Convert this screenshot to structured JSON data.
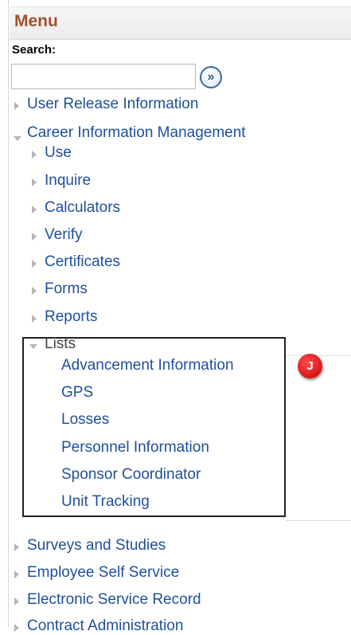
{
  "menu": {
    "title": "Menu"
  },
  "search": {
    "label": "Search:",
    "value": "",
    "go_icon": "double-chevron-right",
    "go_glyph": "»"
  },
  "items": {
    "user_release": "User Release Information",
    "career_mgmt": "Career Information Management",
    "use": "Use",
    "inquire": "Inquire",
    "calculators": "Calculators",
    "verify": "Verify",
    "certificates": "Certificates",
    "forms": "Forms",
    "reports": "Reports",
    "lists": "Lists",
    "advancement": "Advancement Information",
    "gps": "GPS",
    "losses": "Losses",
    "personnel": "Personnel Information",
    "sponsor": "Sponsor Coordinator",
    "unit_tracking": "Unit Tracking",
    "surveys": "Surveys and Studies",
    "employee_self_service": "Employee Self Service",
    "electronic_service_record": "Electronic Service Record",
    "contract_admin": "Contract Administration"
  },
  "callout": {
    "letter": "J",
    "color": "#d40000"
  },
  "colors": {
    "link": "#1f4f99",
    "menu_title": "#a0522d",
    "highlight_box": "#222222"
  }
}
